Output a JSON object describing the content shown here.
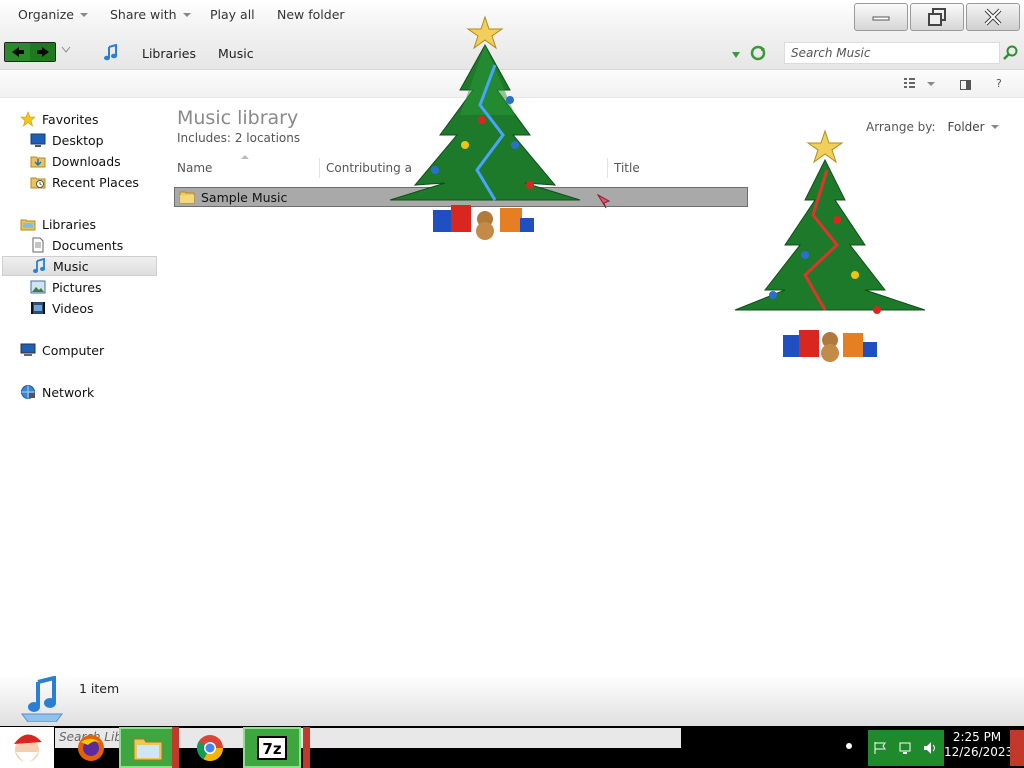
{
  "window": {
    "breadcrumb": [
      "Libraries",
      "Music"
    ],
    "search_placeholder": "Search Music"
  },
  "toolbar": {
    "organize": "Organize",
    "share_with": "Share with",
    "play_all": "Play all",
    "new_folder": "New folder"
  },
  "nav": {
    "favorites": "Favorites",
    "desktop": "Desktop",
    "downloads": "Downloads",
    "recent_places": "Recent Places",
    "libraries": "Libraries",
    "documents": "Documents",
    "music": "Music",
    "pictures": "Pictures",
    "videos": "Videos",
    "computer": "Computer",
    "network": "Network"
  },
  "content": {
    "title": "Music library",
    "includes_label": "Includes:",
    "includes_value": "2 locations",
    "arrange_label": "Arrange by:",
    "arrange_value": "Folder",
    "columns": {
      "name": "Name",
      "contributing": "Contributing a",
      "title": "Title"
    },
    "rows": [
      {
        "name": "Sample Music"
      }
    ]
  },
  "status": {
    "item_count": "1 item"
  },
  "taskbar": {
    "search_text": "Search Libr",
    "time": "2:25 PM",
    "date": "12/26/2023"
  },
  "colors": {
    "selected_row": "#a9a9a9",
    "taskbar_active": "#3ea63e",
    "title_text": "#8a8a8a"
  },
  "icons": {
    "back": "back-arrow-icon",
    "forward": "forward-arrow-icon",
    "music_note": "music-note-icon",
    "search": "search-icon",
    "folder": "folder-icon"
  }
}
